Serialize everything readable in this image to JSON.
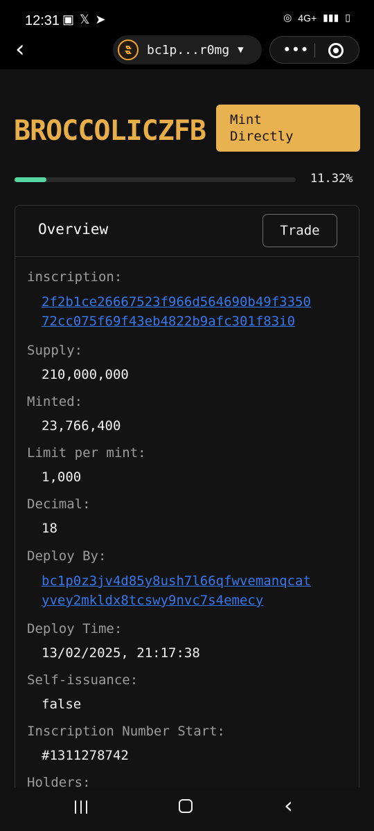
{
  "status": {
    "time": "12:31",
    "network": "4G+"
  },
  "header": {
    "wallet_label": "bc1p...r0mg"
  },
  "token": {
    "name": "BROCCOLICZFB",
    "mint_button": "Mint\nDirectly",
    "progress": 11.32,
    "progress_label": "11.32%"
  },
  "card": {
    "tab": "Overview",
    "trade_button": "Trade",
    "fields": {
      "inscription_label": "inscription:",
      "inscription_value": "2f2b1ce26667523f966d564690b49f3350\n72cc075f69f43eb4822b9afc301f83i0",
      "supply_label": "Supply:",
      "supply_value": "210,000,000",
      "minted_label": "Minted:",
      "minted_value": "23,766,400",
      "limit_label": "Limit per mint:",
      "limit_value": "1,000",
      "decimal_label": "Decimal:",
      "decimal_value": "18",
      "deploy_by_label": "Deploy By:",
      "deploy_by_value": "bc1p0z3jv4d85y8ush7l66qfwvemanqcat\nyvey2mkldx8tcswy9nvc7s4emecy",
      "deploy_time_label": "Deploy Time:",
      "deploy_time_value": "13/02/2025, 21:17:38",
      "self_issuance_label": "Self-issuance:",
      "self_issuance_value": "false",
      "inscription_start_label": "Inscription Number Start:",
      "inscription_start_value": "#1311278742",
      "holders_label": "Holders:"
    }
  },
  "colors": {
    "accent": "#e7b24f",
    "progress": "#55d6a3",
    "link": "#3777ee"
  },
  "icons": {
    "back": "chevron-left-icon",
    "wallet": "wallet-logo-icon",
    "dropdown": "caret-down-icon",
    "more": "more-icon",
    "target": "target-icon"
  }
}
